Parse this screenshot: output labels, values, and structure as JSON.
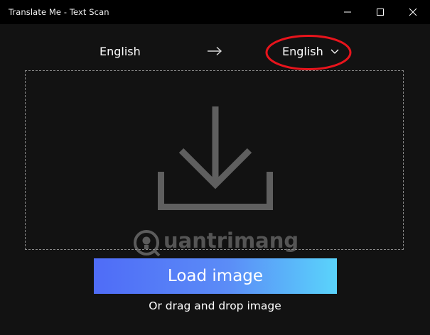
{
  "window": {
    "title": "Translate Me - Text Scan"
  },
  "title_bar": {
    "minimize_icon": "minimize-icon",
    "maximize_icon": "maximize-icon",
    "close_icon": "close-icon"
  },
  "language_bar": {
    "source_language": "English",
    "arrow_icon": "arrow-right-icon",
    "target_language": "English",
    "dropdown_icon": "chevron-down-icon",
    "highlight_color": "#e8141c"
  },
  "drop_zone": {
    "icon": "download-icon"
  },
  "watermark": {
    "text": "uantrimang",
    "logo": "quantrimang-logo"
  },
  "actions": {
    "load_button_label": "Load image",
    "load_button_gradient": [
      "#4f6cf7",
      "#5ad4fb"
    ],
    "drag_hint": "Or drag and drop image"
  }
}
